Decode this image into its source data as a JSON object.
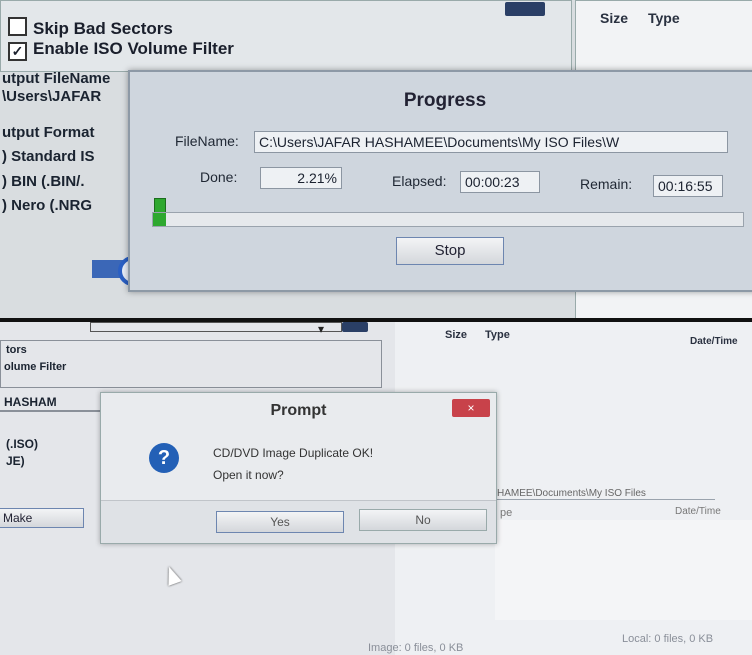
{
  "top_screen": {
    "options": {
      "skip_bad_sectors": {
        "label": "Skip Bad Sectors",
        "checked": false
      },
      "enable_iso_filter": {
        "label": "Enable ISO Volume Filter",
        "checked": true
      }
    },
    "output_filename_label": "utput FileName",
    "output_path_fragment": "\\Users\\JAFAR",
    "output_format_label": "utput Format",
    "formats": [
      {
        "label": ") Standard IS"
      },
      {
        "label": ") BIN (.BIN/."
      },
      {
        "label": ") Nero (.NRG"
      }
    ],
    "list_columns": {
      "size": "Size",
      "type": "Type"
    },
    "progress_dialog": {
      "title": "Progress",
      "filename_label": "FileName:",
      "filename_value": "C:\\Users\\JAFAR HASHAMEE\\Documents\\My ISO Files\\W",
      "done_label": "Done:",
      "done_value": "2.21%",
      "elapsed_label": "Elapsed:",
      "elapsed_value": "00:00:23",
      "remain_label": "Remain:",
      "remain_value": "00:16:55",
      "progress_fraction": 0.0221,
      "progress_color": "#2ea82f",
      "stop_label": "Stop"
    }
  },
  "bottom_screen": {
    "left_fragments": {
      "line1": "tors",
      "line2": "olume Filter",
      "user": "HASHAM",
      "iso": "(.ISO)",
      "je": "JE)",
      "make_button": "Make"
    },
    "list_columns": {
      "size": "Size",
      "type": "Type",
      "datetime": "Date/Time"
    },
    "path_fragment": "HAMEE\\Documents\\My ISO Files",
    "lower_columns": {
      "type_frag": "pe",
      "datetime": "Date/Time"
    },
    "status": {
      "image": "Image: 0 files, 0 KB",
      "local": "Local: 0 files, 0 KB"
    },
    "prompt_dialog": {
      "title": "Prompt",
      "close_label": "×",
      "icon": "question-icon",
      "icon_color": "#2360b6",
      "icon_glyph": "?",
      "message_line1": "CD/DVD Image Duplicate OK!",
      "message_line2": "Open it now?",
      "yes_label": "Yes",
      "no_label": "No"
    }
  }
}
